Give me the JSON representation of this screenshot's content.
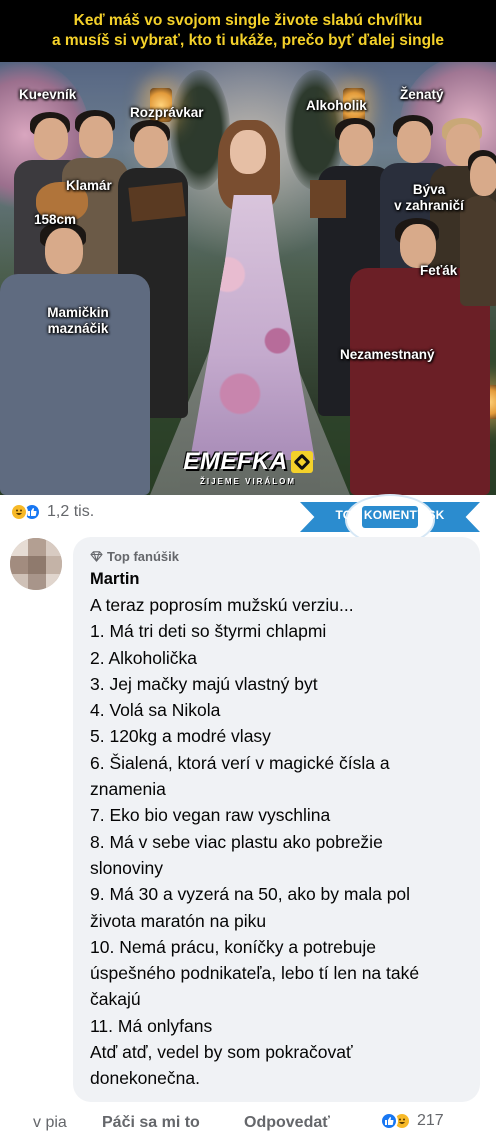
{
  "meme": {
    "caption_line_1": "Keď máš vo svojom single živote slabú chvíľku",
    "caption_line_2": "a musíš si vybrať, kto ti ukáže, prečo byť ďalej single",
    "labels": {
      "kucevnik": "Ku•evník",
      "rozpravkar": "Rozprávkar",
      "alkoholik": "Alkoholik",
      "zenaty": "Ženatý",
      "klamar": "Klamár",
      "byva_line_1": "Býva",
      "byva_line_2": "v zahraničí",
      "height_158": "158cm",
      "fetak": "Feťák",
      "mamickin_line_1": "Mamičkin",
      "mamickin_line_2": "maznáčik",
      "nezamestnany": "Nezamestnaný"
    },
    "logo_text": "EMEFKA",
    "logo_sub": "ŽIJEME VIRÁLOM"
  },
  "post_reactions": {
    "icons": [
      "haha-icon",
      "like-icon"
    ],
    "count": "1,2 tis."
  },
  "top_comments_badge": "TOP KOMENTY.SK",
  "comment": {
    "badge": "Top fanúšik",
    "author": "Martin",
    "lines": [
      "A teraz poprosím mužskú verziu...",
      "1. Má tri deti so štyrmi chlapmi",
      "2. Alkoholička",
      "3. Jej mačky majú vlastný byt",
      "4. Volá sa Nikola",
      "5. 120kg a modré vlasy",
      "6. Šialená, ktorá verí v magické čísla a",
      "znamenia",
      "7. Eko bio vegan raw vyschlina",
      "8. Má v sebe viac plastu ako pobrežie",
      "slonoviny",
      "9. Má 30 a vyzerá na 50, ako by mala pol",
      "života maratón na piku",
      "10. Nemá prácu, koníčky a potrebuje",
      "úspešného podnikateľa, lebo tí len na také",
      "čakajú",
      "11. Má onlyfans",
      "Atď atď, vedel by som pokračovať",
      "donekonečna."
    ],
    "actions": {
      "time": "v pia",
      "like": "Páči sa mi to",
      "reply": "Odpovedať",
      "reaction_count": "217"
    }
  },
  "colors": {
    "caption_text": "#f4d12a",
    "facebook_blue": "#1877f2",
    "bubble_bg": "#f0f2f5",
    "secondary_text": "#65676b",
    "badge_blue": "#2b8ccf"
  }
}
